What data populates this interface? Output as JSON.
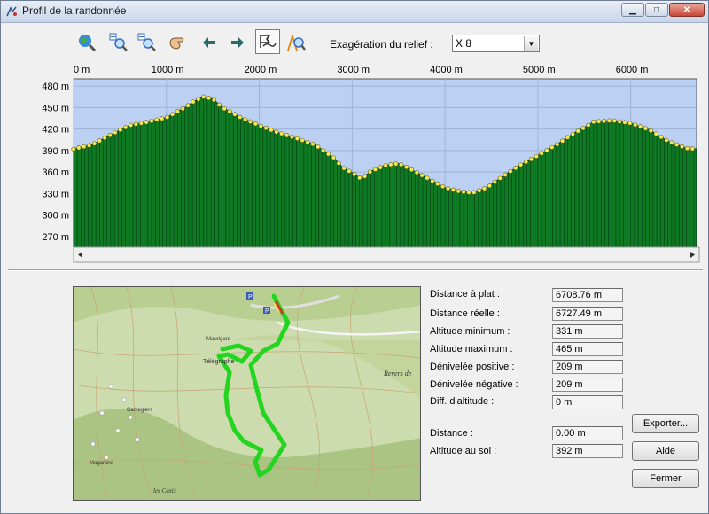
{
  "window": {
    "title": "Profil de la randonnée",
    "icon": "hiker-profile-icon"
  },
  "toolbar": {
    "icons": [
      "globe-zoom-icon",
      "zoom-in-icon",
      "zoom-out-icon",
      "hand-pan-icon",
      "arrow-left-icon",
      "arrow-right-icon",
      "profile-mode-icon",
      "measure-icon"
    ],
    "active": "profile-mode-icon",
    "relief_label": "Exagération du relief :",
    "relief_value": "X 8"
  },
  "chart_data": {
    "type": "area",
    "x_tick_labels": [
      "0 m",
      "1000 m",
      "2000 m",
      "3000 m",
      "4000 m",
      "5000 m",
      "6000 m"
    ],
    "y_tick_labels": [
      "480 m",
      "450 m",
      "420 m",
      "390 m",
      "360 m",
      "330 m",
      "300 m",
      "270 m"
    ],
    "xlim": [
      0,
      6709
    ],
    "ylim": [
      255,
      490
    ],
    "y_ticks": [
      480,
      450,
      420,
      390,
      360,
      330,
      300,
      270
    ],
    "x_ticks": [
      0,
      1000,
      2000,
      3000,
      4000,
      5000,
      6000
    ],
    "grid": true,
    "colors": {
      "background": "#bcd0f4",
      "fill": "#0e7a24",
      "marker": "#f2e85a"
    },
    "points": [
      [
        0,
        392
      ],
      [
        200,
        398
      ],
      [
        400,
        412
      ],
      [
        600,
        425
      ],
      [
        800,
        430
      ],
      [
        1000,
        436
      ],
      [
        1200,
        450
      ],
      [
        1300,
        459
      ],
      [
        1400,
        465
      ],
      [
        1500,
        462
      ],
      [
        1600,
        450
      ],
      [
        1800,
        436
      ],
      [
        2000,
        425
      ],
      [
        2200,
        415
      ],
      [
        2400,
        407
      ],
      [
        2600,
        398
      ],
      [
        2800,
        380
      ],
      [
        2900,
        366
      ],
      [
        3000,
        359
      ],
      [
        3100,
        350
      ],
      [
        3200,
        361
      ],
      [
        3350,
        369
      ],
      [
        3500,
        372
      ],
      [
        3600,
        366
      ],
      [
        3800,
        352
      ],
      [
        4000,
        338
      ],
      [
        4150,
        333
      ],
      [
        4300,
        331
      ],
      [
        4450,
        338
      ],
      [
        4600,
        352
      ],
      [
        4800,
        369
      ],
      [
        5000,
        383
      ],
      [
        5200,
        398
      ],
      [
        5400,
        415
      ],
      [
        5500,
        422
      ],
      [
        5600,
        430
      ],
      [
        5800,
        432
      ],
      [
        6000,
        428
      ],
      [
        6200,
        419
      ],
      [
        6400,
        403
      ],
      [
        6600,
        393
      ],
      [
        6709,
        392
      ]
    ]
  },
  "map": {
    "labels": [
      "Télégraphe",
      "Revers de",
      "Camegiers",
      "Magarane",
      "Maurigard",
      "les Cenix"
    ]
  },
  "stats": [
    {
      "label": "Distance à plat :",
      "value": "6708.76 m"
    },
    {
      "label": "Distance réelle :",
      "value": "6727.49 m"
    },
    {
      "label": "Altitude minimum :",
      "value": "331 m"
    },
    {
      "label": "Altitude maximum :",
      "value": "465 m"
    },
    {
      "label": "Dénivelée positive :",
      "value": "209 m"
    },
    {
      "label": "Dénivelée négative :",
      "value": "209 m"
    },
    {
      "label": "Diff. d'altitude :",
      "value": "0 m"
    },
    {
      "label": "Distance :",
      "value": "0.00 m"
    },
    {
      "label": "Altitude au sol :",
      "value": "392 m"
    }
  ],
  "buttons": {
    "export": "Exporter...",
    "help": "Aide",
    "close": "Fermer"
  }
}
